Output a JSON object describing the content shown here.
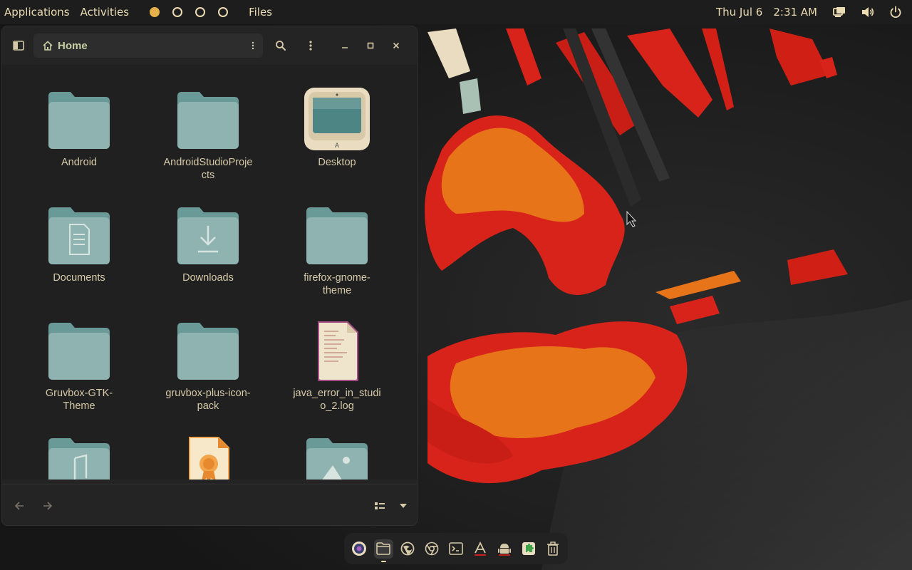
{
  "topbar": {
    "applications": "Applications",
    "activities": "Activities",
    "app_name": "Files",
    "date": "Thu Jul 6",
    "time": "2:31 AM",
    "workspaces": [
      {
        "active": true
      },
      {
        "active": false
      },
      {
        "active": false
      },
      {
        "active": false
      }
    ],
    "indicator_icons": [
      "network-icon",
      "volume-icon",
      "power-icon"
    ]
  },
  "window": {
    "path_label": "Home",
    "path_icon": "home-icon",
    "header_buttons": [
      "sidebar-toggle-icon",
      "path-menu-icon",
      "search-icon",
      "main-menu-icon",
      "minimize-icon",
      "maximize-icon",
      "close-icon"
    ]
  },
  "files": [
    {
      "name": "Android",
      "icon": "folder-icon"
    },
    {
      "name": "AndroidStudioProjects",
      "icon": "folder-icon"
    },
    {
      "name": "Desktop",
      "icon": "desktop-folder-icon"
    },
    {
      "name": "Documents",
      "icon": "documents-folder-icon"
    },
    {
      "name": "Downloads",
      "icon": "downloads-folder-icon"
    },
    {
      "name": "firefox-gnome-theme",
      "icon": "folder-icon"
    },
    {
      "name": "Gruvbox-GTK-Theme",
      "icon": "folder-icon"
    },
    {
      "name": "gruvbox-plus-icon-pack",
      "icon": "folder-icon"
    },
    {
      "name": "java_error_in_studio_2.log",
      "icon": "text-file-icon"
    },
    {
      "name": "",
      "icon": "music-folder-icon"
    },
    {
      "name": "",
      "icon": "certificate-file-icon"
    },
    {
      "name": "",
      "icon": "pictures-folder-icon"
    }
  ],
  "labels_wrapped": {
    "android": "Android",
    "android_studio_1": "AndroidStudioProje",
    "android_studio_2": "cts",
    "desktop": "Desktop",
    "documents": "Documents",
    "downloads": "Downloads",
    "firefox_1": "firefox-gnome-",
    "firefox_2": "theme",
    "gruvbox_gtk_1": "Gruvbox-GTK-",
    "gruvbox_gtk_2": "Theme",
    "gruvbox_plus_1": "gruvbox-plus-icon-",
    "gruvbox_plus_2": "pack",
    "java_1": "java_error_in_studi",
    "java_2": "o_2.log"
  },
  "statusbar": {
    "buttons": [
      "back-icon",
      "forward-icon",
      "view-mode-icon",
      "view-options-chevron-icon"
    ]
  },
  "dock": {
    "apps": [
      {
        "icon": "screenshot-app-icon",
        "running": false,
        "active": false
      },
      {
        "icon": "files-app-icon",
        "running": true,
        "active": true
      },
      {
        "icon": "firefox-icon",
        "running": false,
        "active": false
      },
      {
        "icon": "chrome-icon",
        "running": false,
        "active": false
      },
      {
        "icon": "terminal-icon",
        "running": false,
        "active": false
      },
      {
        "icon": "text-editor-icon",
        "running": false,
        "active": false
      },
      {
        "icon": "android-studio-icon",
        "running": false,
        "active": false
      },
      {
        "icon": "extensions-icon",
        "running": false,
        "active": false
      },
      {
        "icon": "trash-icon",
        "running": false,
        "active": false
      }
    ]
  },
  "colors": {
    "accent": "#e6b04a",
    "folder": "#8fb3b0",
    "folder_tab": "#6a9a98",
    "text": "#ebdbb2",
    "wallpaper_red": "#d8231a",
    "wallpaper_orange": "#e8741a"
  }
}
